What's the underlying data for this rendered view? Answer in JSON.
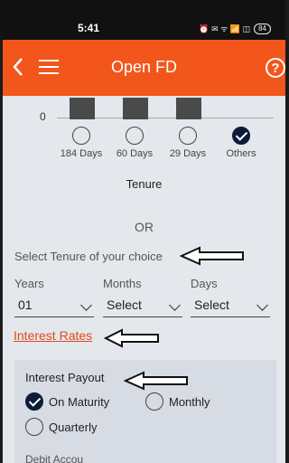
{
  "status_bar": {
    "time": "5:41",
    "icons_text": "⏰ ✉ ᯤ 📶 ◫",
    "battery": "84"
  },
  "header": {
    "title": "Open FD",
    "help_symbol": "?"
  },
  "tenure_chart": {
    "zero_label": "0",
    "options": [
      {
        "label": "184 Days",
        "selected": false
      },
      {
        "label": "60 Days",
        "selected": false
      },
      {
        "label": "29 Days",
        "selected": false
      },
      {
        "label": "Others",
        "selected": true
      }
    ],
    "caption": "Tenure"
  },
  "or_text": "OR",
  "select_tenure_text": "Select Tenure of your choice",
  "fields": {
    "years": {
      "label": "Years",
      "value": "01"
    },
    "months": {
      "label": "Months",
      "value": "Select"
    },
    "days": {
      "label": "Days",
      "value": "Select"
    }
  },
  "interest_rates_link": "Interest Rates",
  "interest_payout": {
    "title": "Interest Payout",
    "options": [
      {
        "label": "On Maturity",
        "selected": true
      },
      {
        "label": "Monthly",
        "selected": false
      },
      {
        "label": "Quarterly",
        "selected": false
      }
    ]
  },
  "debit_account_label": "Debit Accou",
  "colors": {
    "header_bg": "#f2561b",
    "link": "#e04a1b",
    "checked_radio": "#0c1b3a"
  }
}
